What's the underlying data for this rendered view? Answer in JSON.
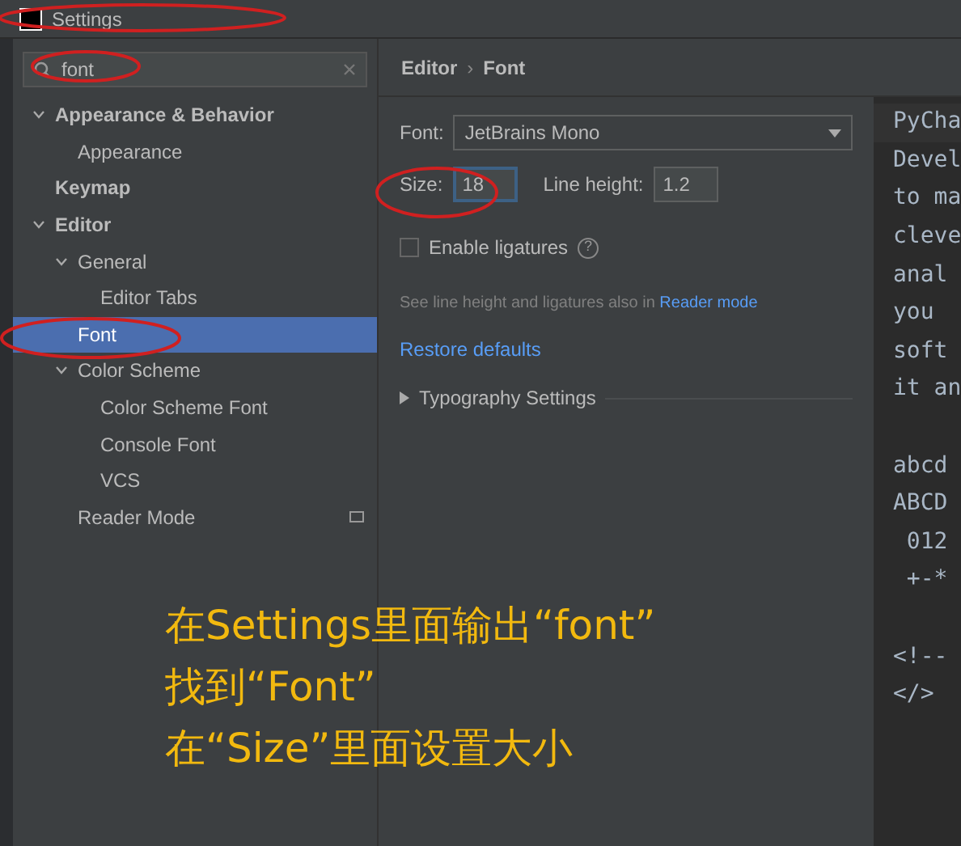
{
  "window": {
    "title": "Settings"
  },
  "search": {
    "value": "font"
  },
  "tree": [
    {
      "label": "Appearance & Behavior",
      "bold": true,
      "expanded": true,
      "selected": false,
      "children": [
        {
          "label": "Appearance",
          "bold": false,
          "selected": false
        }
      ]
    },
    {
      "label": "Keymap",
      "bold": true,
      "selected": false
    },
    {
      "label": "Editor",
      "bold": true,
      "expanded": true,
      "selected": false,
      "children": [
        {
          "label": "General",
          "bold": false,
          "expanded": true,
          "selected": false,
          "children": [
            {
              "label": "Editor Tabs",
              "bold": false,
              "selected": false
            }
          ]
        },
        {
          "label": "Font",
          "bold": false,
          "selected": true
        },
        {
          "label": "Color Scheme",
          "bold": false,
          "expanded": true,
          "selected": false,
          "children": [
            {
              "label": "Color Scheme Font",
              "bold": false,
              "selected": false
            },
            {
              "label": "Console Font",
              "bold": false,
              "selected": false
            },
            {
              "label": "VCS",
              "bold": false,
              "selected": false
            }
          ]
        },
        {
          "label": "Reader Mode",
          "bold": false,
          "selected": false,
          "has_badge": true
        }
      ]
    }
  ],
  "breadcrumb": [
    "Editor",
    "›",
    "Font"
  ],
  "font": {
    "label": "Font:",
    "value": "JetBrains Mono"
  },
  "size": {
    "label": "Size:",
    "value": "18"
  },
  "line_height": {
    "label": "Line height:",
    "value": "1.2"
  },
  "ligatures": {
    "label": "Enable ligatures",
    "checked": false,
    "help": "?"
  },
  "hint": {
    "text": "See line height and ligatures also in",
    "link": "Reader mode"
  },
  "restore_link": "Restore defaults",
  "typography": {
    "label": "Typography Settings",
    "expanded": false
  },
  "preview_blocks": [
    [
      "PyCha",
      "Devel",
      "to ma",
      "cleve",
      "anal",
      "you",
      "soft",
      "it an"
    ],
    [
      "abcd",
      "ABCD",
      " 012",
      " +-*"
    ],
    [
      "<!--",
      "</>"
    ]
  ],
  "caption": [
    "在Settings里面输出“font”",
    "找到“Font”",
    "在“Size”里面设置大小"
  ]
}
